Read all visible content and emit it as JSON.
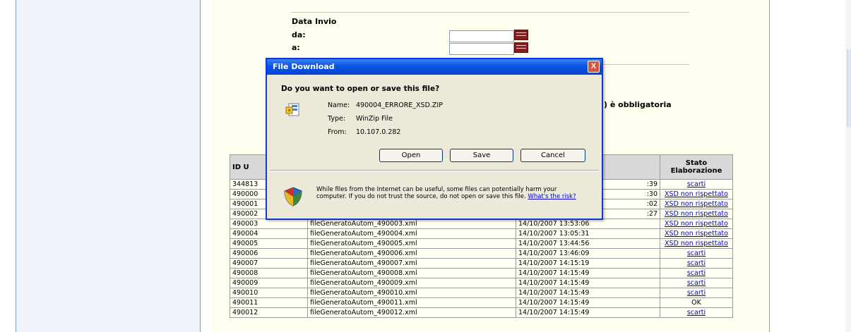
{
  "form": {
    "section_title": "Data Invio",
    "from_label": "da:",
    "to_label": "a:",
    "required_note": ") è obbligatoria"
  },
  "dialog": {
    "title": "File Download",
    "close_label": "X",
    "question": "Do you want to open or save this file?",
    "name_label": "Name:",
    "name_value": "490004_ERRORE_XSD.ZIP",
    "type_label": "Type:",
    "type_value": "WinZip File",
    "from_label": "From:",
    "from_value": "10.107.0.282",
    "open_label": "Open",
    "save_label": "Save",
    "cancel_label": "Cancel",
    "warning_text": "While files from the Internet can be useful, some files can potentially harm your computer. If you do not trust the source, do not open or save this file.",
    "warning_link": "What's the risk?"
  },
  "table": {
    "col_id": "ID U",
    "col_stato_line1": "Stato",
    "col_stato_line2": "Elaborazione",
    "rows": [
      {
        "id": "344813",
        "file": "",
        "date": ":39",
        "stato": "scarti"
      },
      {
        "id": "490000",
        "file": "",
        "date": ":30",
        "stato": "XSD non rispettato"
      },
      {
        "id": "490001",
        "file": "",
        "date": ":02",
        "stato": "XSD non rispettato"
      },
      {
        "id": "490002",
        "file": "",
        "date": ":27",
        "stato": "XSD non rispettato"
      },
      {
        "id": "490003",
        "file": "fileGeneratoAutom_490003.xml",
        "date": "14/10/2007 13:53:06",
        "stato": "XSD non rispettato"
      },
      {
        "id": "490004",
        "file": "fileGeneratoAutom_490004.xml",
        "date": "14/10/2007 13:05:31",
        "stato": "XSD non rispettato"
      },
      {
        "id": "490005",
        "file": "fileGeneratoAutom_490005.xml",
        "date": "14/10/2007 13:44:56",
        "stato": "XSD non rispettato"
      },
      {
        "id": "490006",
        "file": "fileGeneratoAutom_490006.xml",
        "date": "14/10/2007 13:46:09",
        "stato": "scarti"
      },
      {
        "id": "490007",
        "file": "fileGeneratoAutom_490007.xml",
        "date": "14/10/2007 14:15:19",
        "stato": "scarti"
      },
      {
        "id": "490008",
        "file": "fileGeneratoAutom_490008.xml",
        "date": "14/10/2007 14:15:49",
        "stato": "scarti"
      },
      {
        "id": "490009",
        "file": "fileGeneratoAutom_490009.xml",
        "date": "14/10/2007 14:15:49",
        "stato": "scarti"
      },
      {
        "id": "490010",
        "file": "fileGeneratoAutom_490010.xml",
        "date": "14/10/2007 14:15:49",
        "stato": "scarti"
      },
      {
        "id": "490011",
        "file": "fileGeneratoAutom_490011.xml",
        "date": "14/10/2007 14:15:49",
        "stato": "OK"
      },
      {
        "id": "490012",
        "file": "fileGeneratoAutom_490012.xml",
        "date": "14/10/2007 14:15:49",
        "stato": "scarti"
      }
    ]
  }
}
